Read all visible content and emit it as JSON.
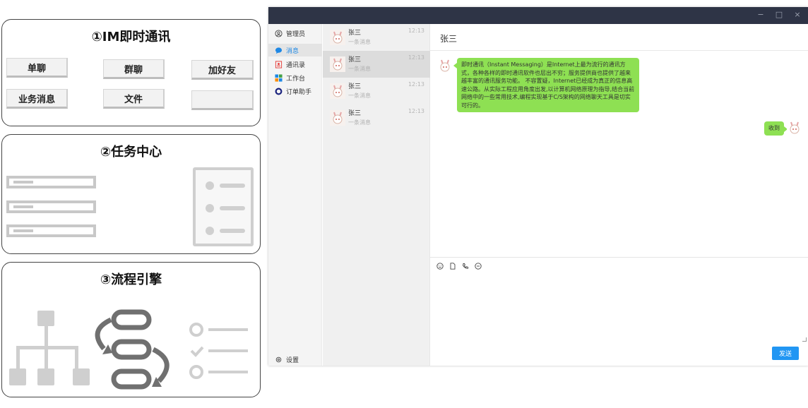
{
  "panels": {
    "im": {
      "title": "①IM即时通讯",
      "buttons": [
        "单聊",
        "群聊",
        "加好友",
        "业务消息",
        "文件",
        ""
      ]
    },
    "task": {
      "title": "②任务中心"
    },
    "flow": {
      "title": "③流程引擎"
    }
  },
  "app": {
    "window_controls": [
      "−",
      "□",
      "×"
    ],
    "nav": {
      "items": [
        {
          "label": "管理员",
          "icon": "user-circle-icon"
        },
        {
          "label": "消息",
          "icon": "chat-bubble-icon",
          "active": true
        },
        {
          "label": "通讯录",
          "icon": "contacts-icon"
        },
        {
          "label": "工作台",
          "icon": "grid-apps-icon"
        },
        {
          "label": "订单助手",
          "icon": "order-ring-icon"
        }
      ],
      "settings_label": "设置",
      "settings_icon": "gear-icon"
    },
    "conversations": [
      {
        "name": "张三",
        "preview": "一条消息",
        "time": "12:13"
      },
      {
        "name": "张三",
        "preview": "一条消息",
        "time": "12:13",
        "active": true
      },
      {
        "name": "张三",
        "preview": "一条消息",
        "time": "12:13"
      },
      {
        "name": "张三",
        "preview": "一条消息",
        "time": "12:13"
      }
    ],
    "chat": {
      "title": "张三",
      "messages": [
        {
          "side": "left",
          "text": "即时通讯（Instant Messaging）是Internet上最为流行的通讯方式，各种各样的即时通讯软件也层出不穷；服务提供商也提供了越来越丰富的通讯服务功能。 不容置疑，Internet已经成为真正的信息高速公路。从实际工程应用角度出发,以计算机网络原理为指导,结合当前网络中的一些常用技术,编程实现基于C/S架构的网络聊天工具是切实可行的。"
        },
        {
          "side": "right",
          "text": "收到"
        }
      ],
      "toolbar_icons": [
        "emoji-icon",
        "file-icon",
        "phone-icon",
        "minus-circle-icon"
      ],
      "input_value": "",
      "send_label": "发送"
    },
    "colors": {
      "titlebar": "#2e3446",
      "accent": "#2196f3",
      "bubble": "#8ee053"
    }
  }
}
